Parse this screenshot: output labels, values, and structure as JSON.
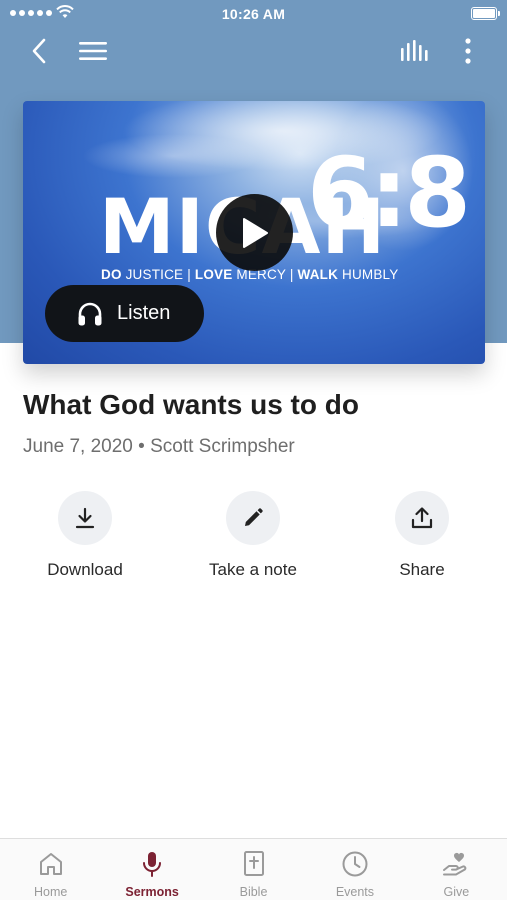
{
  "status_bar": {
    "time": "10:26 AM"
  },
  "nav": {
    "back_icon": "chevron-left-icon",
    "menu_icon": "hamburger-menu-icon",
    "audio_icon": "audio-bars-icon",
    "more_icon": "more-vertical-icon"
  },
  "artwork": {
    "title": "MICAH",
    "reference": "6:8",
    "subtitle_parts": [
      {
        "bold": "DO",
        "normal": " JUSTICE"
      },
      {
        "bold": "LOVE",
        "normal": " MERCY"
      },
      {
        "bold": "WALK",
        "normal": " HUMBLY"
      }
    ],
    "separator": " | "
  },
  "listen_button": {
    "label": "Listen",
    "icon": "headphones-icon"
  },
  "play_button": {
    "icon": "play-icon"
  },
  "sermon": {
    "title": "What God wants us to do",
    "date": "June 7, 2020",
    "separator": " • ",
    "speaker": "Scott Scrimpsher"
  },
  "actions": [
    {
      "label": "Download",
      "icon": "download-icon"
    },
    {
      "label": "Take a note",
      "icon": "pencil-icon"
    },
    {
      "label": "Share",
      "icon": "share-icon"
    }
  ],
  "tabs": [
    {
      "label": "Home",
      "icon": "home-icon",
      "active": false
    },
    {
      "label": "Sermons",
      "icon": "microphone-icon",
      "active": true
    },
    {
      "label": "Bible",
      "icon": "bible-icon",
      "active": false
    },
    {
      "label": "Events",
      "icon": "clock-icon",
      "active": false
    },
    {
      "label": "Give",
      "icon": "give-hand-heart-icon",
      "active": false
    }
  ],
  "colors": {
    "header_bg": "#7199bf",
    "accent": "#7c2233",
    "listen_bg": "#111418",
    "tab_inactive": "#9a9a9a"
  }
}
